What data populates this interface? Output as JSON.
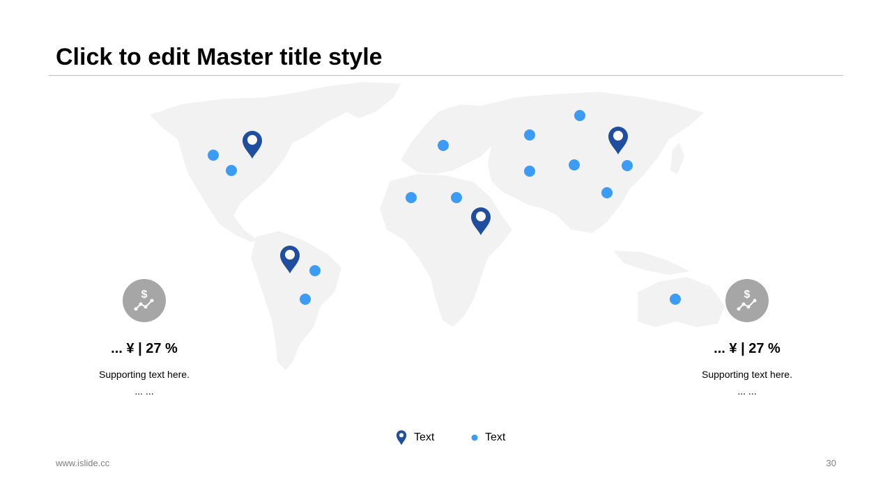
{
  "slide": {
    "title": "Click to edit Master title style",
    "page_number": "30",
    "footer_url": "www.islide.cc"
  },
  "colors": {
    "pin": "#1f4e9f",
    "dot": "#3c9cf5",
    "land": "#f2f2f2",
    "icon_circle": "#a6a6a6"
  },
  "stats": [
    {
      "value": "... ¥ | 27 %",
      "support": "Supporting text here.",
      "more": "... ...",
      "icon": "dollar-trend-icon"
    },
    {
      "value": "... ¥ | 27 %",
      "support": "Supporting text here.",
      "more": "... ...",
      "icon": "dollar-trend-icon"
    }
  ],
  "legend": [
    {
      "icon": "map-pin-icon",
      "label": "Text"
    },
    {
      "icon": "dot-icon",
      "label": "Text"
    }
  ]
}
